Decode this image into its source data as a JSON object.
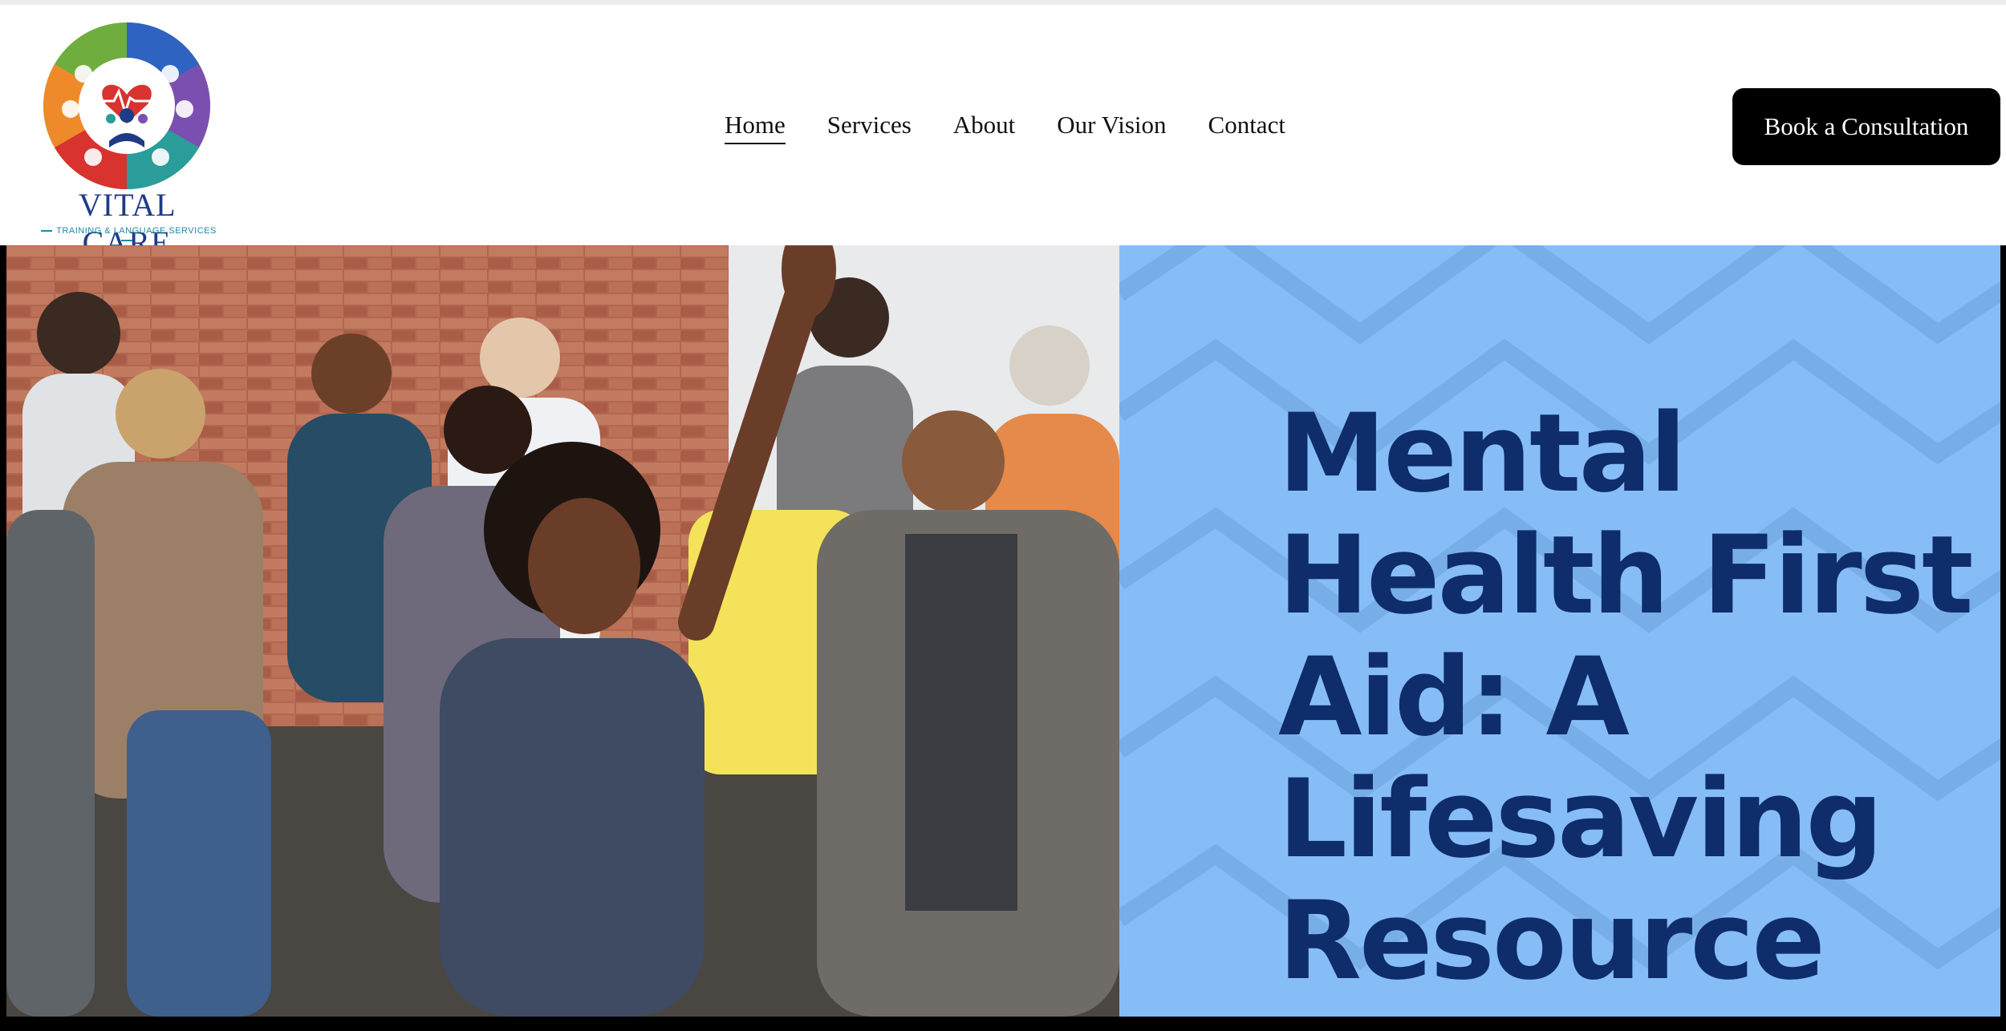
{
  "logo": {
    "brand_first": "VITAL",
    "brand_second": "CARE",
    "tagline": "TRAINING & LANGUAGE SERVICES",
    "icon": "vital-care-logo-icon",
    "colors": [
      "#6fae3e",
      "#2e63c2",
      "#7b4fb0",
      "#2a9d9a",
      "#d8332f",
      "#ef8a2a"
    ]
  },
  "nav": {
    "items": [
      {
        "label": "Home",
        "active": true
      },
      {
        "label": "Services"
      },
      {
        "label": "About"
      },
      {
        "label": "Our Vision"
      },
      {
        "label": "Contact"
      }
    ]
  },
  "cta": {
    "label": "Book a Consultation"
  },
  "hero": {
    "headline": "Mental Health First Aid: A Lifesaving Resource",
    "image": "training-class-photo",
    "panel_color": "#86bdf6",
    "headline_color": "#0f2d6b"
  }
}
